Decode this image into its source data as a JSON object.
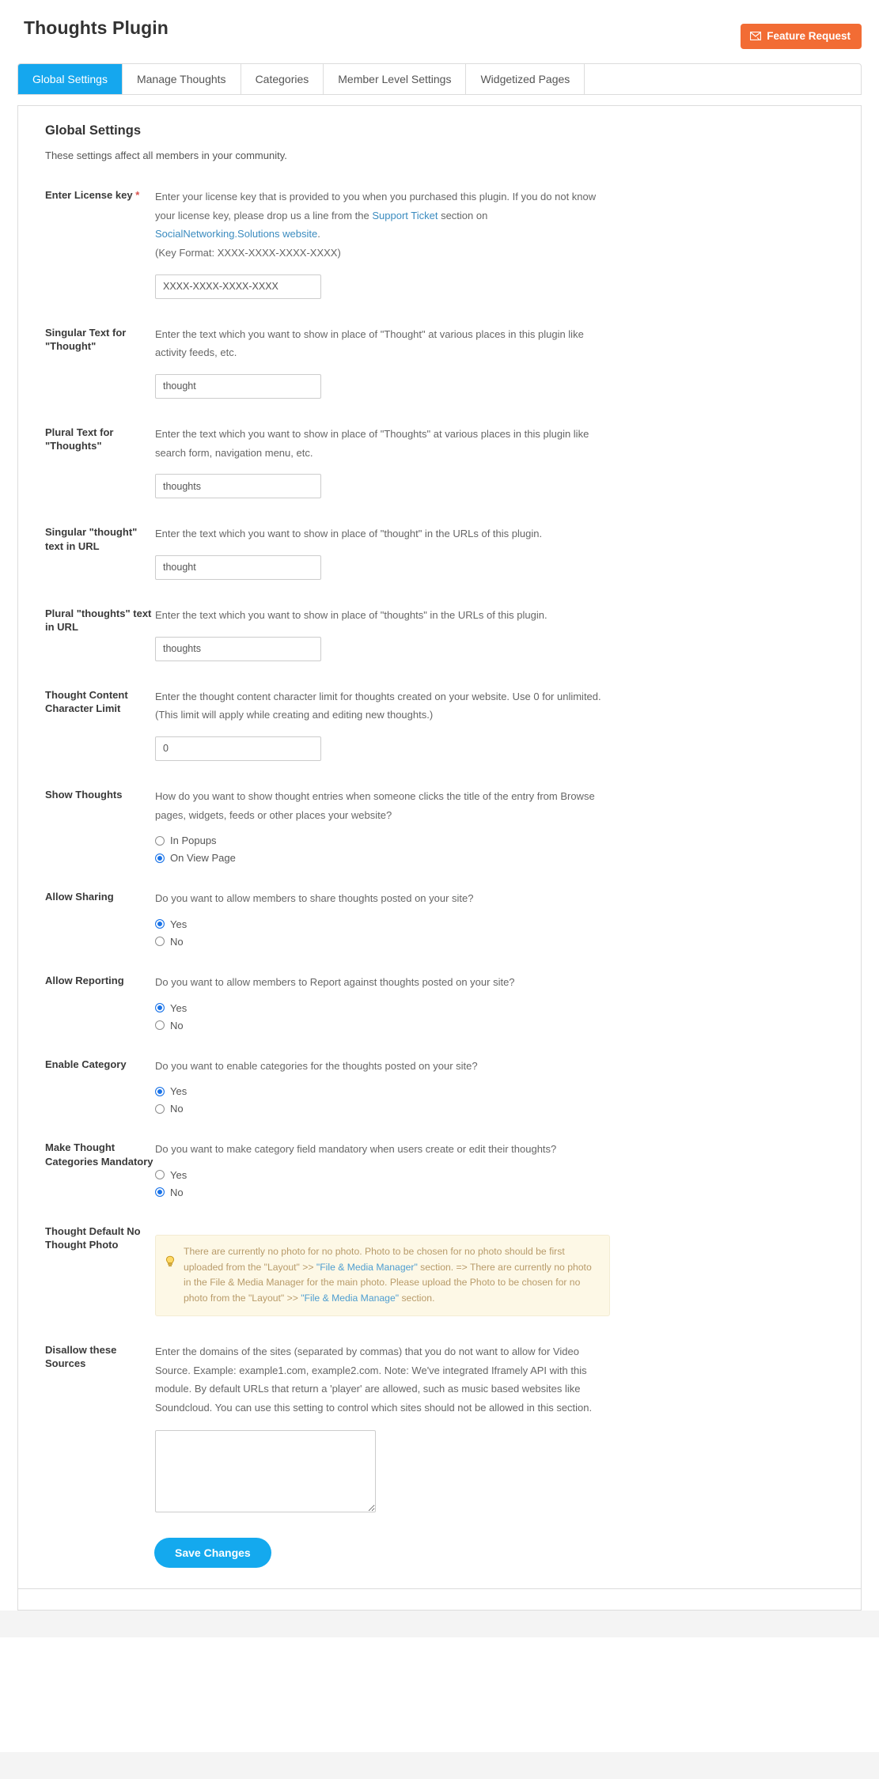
{
  "header": {
    "title": "Thoughts Plugin",
    "feature_request_label": "Feature Request",
    "feature_request_icon": "envelope-icon",
    "feature_request_color": "#f26c34"
  },
  "tabs": [
    {
      "label": "Global Settings",
      "active": true
    },
    {
      "label": "Manage Thoughts",
      "active": false
    },
    {
      "label": "Categories",
      "active": false
    },
    {
      "label": "Member Level Settings",
      "active": false
    },
    {
      "label": "Widgetized Pages",
      "active": false
    }
  ],
  "tab_active_color": "#15a7ee",
  "panel": {
    "title": "Global Settings",
    "subtitle": "These settings affect all members in your community."
  },
  "fields": {
    "license": {
      "label": "Enter License key",
      "required_marker": "*",
      "desc_part1": "Enter your license key that is provided to you when you purchased this plugin. If you do not know your license key, please drop us a line from the ",
      "link1": "Support Ticket",
      "desc_part2": " section on ",
      "link2": "SocialNetworking.Solutions website",
      "desc_part3": ".",
      "desc_line2": "(Key Format: XXXX-XXXX-XXXX-XXXX)",
      "value": "XXXX-XXXX-XXXX-XXXX"
    },
    "singular_text": {
      "label": "Singular Text for \"Thought\"",
      "desc": "Enter the text which you want to show in place of \"Thought\" at various places in this plugin like activity feeds, etc.",
      "value": "thought"
    },
    "plural_text": {
      "label": "Plural Text for \"Thoughts\"",
      "desc": "Enter the text which you want to show in place of \"Thoughts\" at various places in this plugin like search form, navigation menu, etc.",
      "value": "thoughts"
    },
    "singular_url": {
      "label": "Singular \"thought\" text in URL",
      "desc": "Enter the text which you want to show in place of \"thought\" in the URLs of this plugin.",
      "value": "thought"
    },
    "plural_url": {
      "label": "Plural \"thoughts\" text in URL",
      "desc": "Enter the text which you want to show in place of \"thoughts\" in the URLs of this plugin.",
      "value": "thoughts"
    },
    "char_limit": {
      "label": "Thought Content Character Limit",
      "desc_line1": "Enter the thought content character limit for thoughts created on your website. Use 0 for unlimited.",
      "desc_line2": "(This limit will apply while creating and editing new thoughts.)",
      "value": "0"
    },
    "show_thoughts": {
      "label": "Show Thoughts",
      "desc": "How do you want to show thought entries when someone clicks the title of the entry from Browse pages, widgets, feeds or other places your website?",
      "options": [
        {
          "label": "In Popups",
          "selected": false
        },
        {
          "label": "On View Page",
          "selected": true
        }
      ]
    },
    "allow_sharing": {
      "label": "Allow Sharing",
      "desc": "Do you want to allow members to share thoughts posted on your site?",
      "options": [
        {
          "label": "Yes",
          "selected": true
        },
        {
          "label": "No",
          "selected": false
        }
      ]
    },
    "allow_reporting": {
      "label": "Allow Reporting",
      "desc": "Do you want to allow members to Report against thoughts posted on your site?",
      "options": [
        {
          "label": "Yes",
          "selected": true
        },
        {
          "label": "No",
          "selected": false
        }
      ]
    },
    "enable_category": {
      "label": "Enable Category",
      "desc": "Do you want to enable categories for the thoughts posted on your site?",
      "options": [
        {
          "label": "Yes",
          "selected": true
        },
        {
          "label": "No",
          "selected": false
        }
      ]
    },
    "categories_mandatory": {
      "label": "Make Thought Categories Mandatory",
      "desc": "Do you want to make category field mandatory when users create or edit their thoughts?",
      "options": [
        {
          "label": "Yes",
          "selected": false
        },
        {
          "label": "No",
          "selected": true
        }
      ]
    },
    "default_photo": {
      "label": "Thought Default No Thought Photo",
      "notice_icon": "lightbulb-icon",
      "notice_part1": "There are currently no photo for no photo. Photo to be chosen for no photo should be first uploaded from the \"Layout\" >> ",
      "notice_link1": "\"File & Media Manager\"",
      "notice_part2": " section. => There are currently no photo in the File & Media Manager for the main photo. Please upload the Photo to be chosen for no photo from the \"Layout\" >> ",
      "notice_link2": "\"File & Media Manage\"",
      "notice_part3": " section."
    },
    "disallow_sources": {
      "label": "Disallow these Sources",
      "desc": "Enter the domains of the sites (separated by commas) that you do not want to allow for Video Source. Example: example1.com, example2.com. Note: We've integrated Iframely API with this module. By default URLs that return a 'player' are allowed, such as music based websites like Soundcloud. You can use this setting to control which sites should not be allowed in this section.",
      "value": ""
    }
  },
  "save": {
    "label": "Save Changes",
    "color": "#14a9ee"
  }
}
